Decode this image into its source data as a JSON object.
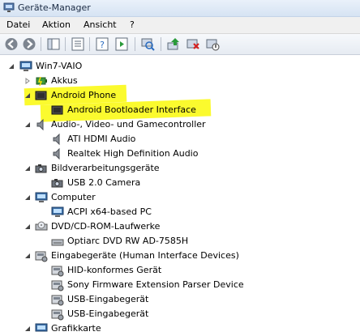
{
  "window": {
    "title": "Geräte-Manager"
  },
  "menu": {
    "items": [
      "Datei",
      "Aktion",
      "Ansicht",
      "?"
    ]
  },
  "tree": {
    "root": "Win7-VAIO",
    "nodes": [
      "Akkus",
      "Android Phone",
      "Android Bootloader Interface",
      "Audio-, Video- und Gamecontroller",
      "ATI HDMI Audio",
      "Realtek High Definition Audio",
      "Bildverarbeitungsgeräte",
      "USB 2.0 Camera",
      "Computer",
      "ACPI x64-based PC",
      "DVD/CD-ROM-Laufwerke",
      "Optiarc DVD RW AD-7585H",
      "Eingabegeräte (Human Interface Devices)",
      "HID-konformes Gerät",
      "Sony Firmware Extension Parser Device",
      "USB-Eingabegerät",
      "USB-Eingabegerät",
      "Grafikkarte"
    ]
  },
  "colors": {
    "highlight": "#fbfa2e",
    "toolbar_icon": "#2a6cc0"
  }
}
